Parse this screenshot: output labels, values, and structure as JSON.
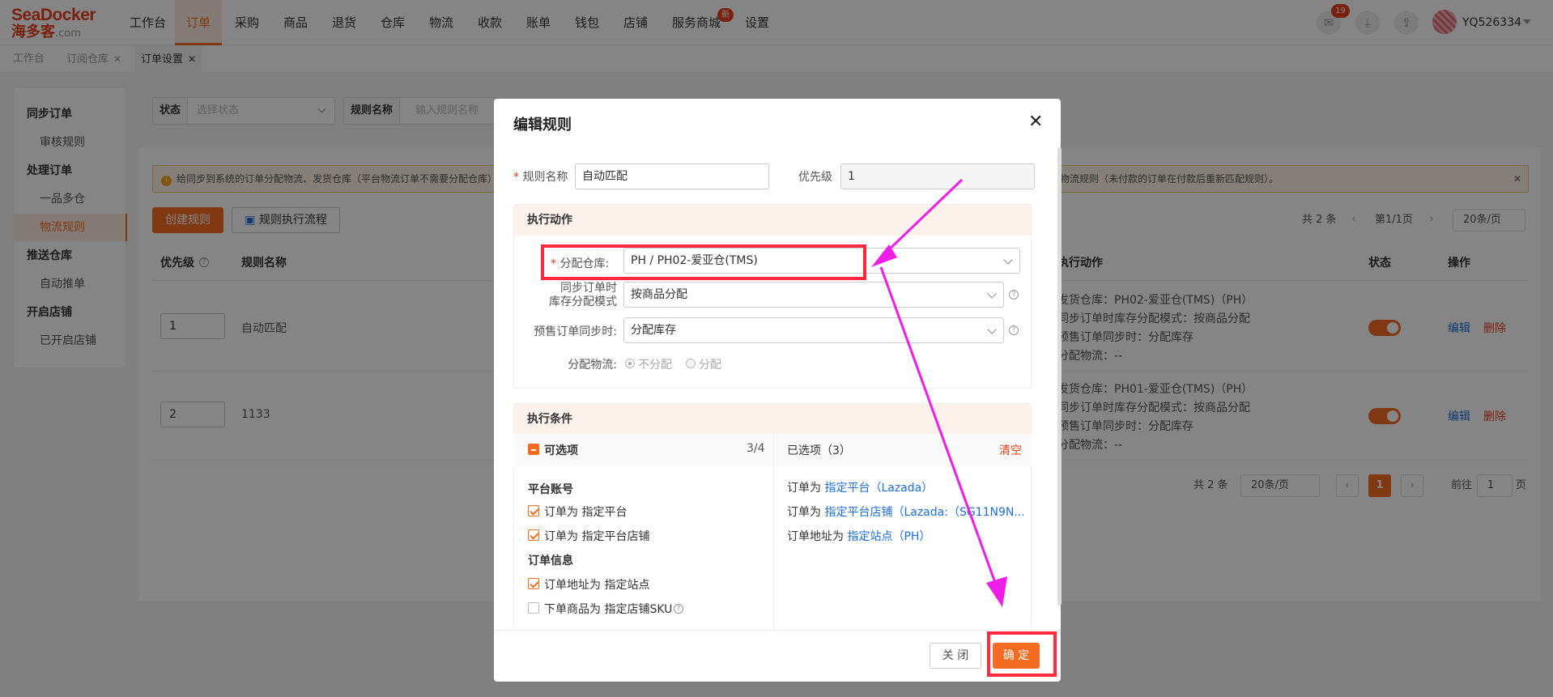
{
  "brand": {
    "line1": "SeaDocker",
    "line2": "海多客",
    "suffix": ".com"
  },
  "nav": [
    "工作台",
    "订单",
    "采购",
    "商品",
    "退货",
    "仓库",
    "物流",
    "收款",
    "账单",
    "钱包",
    "店铺",
    "服务商城",
    "设置"
  ],
  "nav_badge": "新",
  "notify_count": "19",
  "username": "YQ526334",
  "page_tabs": [
    "工作台",
    "订阅仓库",
    "订单设置"
  ],
  "sidebar": {
    "sync": "同步订单",
    "review": "审核规则",
    "process": "处理订单",
    "one_sku": "一品多仓",
    "logistics": "物流规则",
    "push": "推送仓库",
    "auto_push": "自动推单",
    "open": "开启店铺",
    "opened": "已开启店铺"
  },
  "filters": {
    "status_label": "状态",
    "status_ph": "选择状态",
    "name_label": "规则名称",
    "name_ph": "输入规则名称"
  },
  "alert": {
    "left": "给同步到系统的订单分配物流、发货仓库（平台物流订单不需要分配仓库）",
    "right": "物流规则（未付款的订单在付款后重新匹配规则）。"
  },
  "buttons": {
    "create": "创建规则",
    "flow": "规则执行流程"
  },
  "pager_top": {
    "total": "共 2 条",
    "page": "第1/1页",
    "size": "20条/页"
  },
  "table": {
    "headers": {
      "priority": "优先级",
      "name": "规则名称",
      "action": "执行动作",
      "status": "状态",
      "ops": "操作"
    },
    "rows": [
      {
        "priority": "1",
        "name": "自动匹配",
        "a1": "发货仓库：PH02-爱亚仓(TMS)（PH）",
        "a2": "同步订单时库存分配模式：按商品分配",
        "a3": "预售订单同步时：分配库存",
        "a4": "分配物流：--",
        "edit": "编辑",
        "del": "删除"
      },
      {
        "priority": "2",
        "name": "1133",
        "a1": "发货仓库：PH01-爱亚仓(TMS)（PH）",
        "a2": "同步订单时库存分配模式：按商品分配",
        "a3": "预售订单同步时：分配库存",
        "a4": "分配物流：--",
        "edit": "编辑",
        "del": "删除"
      }
    ]
  },
  "pager_bottom": {
    "total": "共 2 条",
    "size": "20条/页",
    "current": "1",
    "goto": "前往",
    "goto_val": "1",
    "unit": "页"
  },
  "modal": {
    "title": "编辑规则",
    "rule_name_label": "规则名称",
    "rule_name_value": "自动匹配",
    "priority_label": "优先级",
    "priority_value": "1",
    "action_section": "执行动作",
    "warehouse_label": "分配仓库:",
    "warehouse_value": "PH / PH02-爱亚仓(TMS)",
    "sync_mode_label_1": "同步订单时",
    "sync_mode_label_2": "库存分配模式",
    "sync_mode_value": "按商品分配",
    "presale_label": "预售订单同步时:",
    "presale_value": "分配库存",
    "logistics_label": "分配物流:",
    "logistics_opt1": "不分配",
    "logistics_opt2": "分配",
    "condition_section": "执行条件",
    "optional_title": "可选项",
    "optional_count": "3/4",
    "selected_title": "已选项（3）",
    "clear": "清空",
    "group1": "平台账号",
    "opt1": "订单为 指定平台",
    "opt2": "订单为 指定平台店铺",
    "group2": "订单信息",
    "opt3": "订单地址为 指定站点",
    "opt4": "下单商品为 指定店铺SKU",
    "sel1_prefix": "订单为 ",
    "sel1_link": "指定平台（Lazada）",
    "sel2_prefix": "订单为 ",
    "sel2_link": "指定平台店铺（Lazada:（SG11N9N...",
    "sel3_prefix": "订单地址为 ",
    "sel3_link": "指定站点（PH）",
    "close": "关 闭",
    "ok": "确 定"
  },
  "colors": {
    "accent": "#f36c21",
    "highlight": "#ff2a3d",
    "arrow": "#ee1ee8",
    "link": "#1e6fd9"
  }
}
